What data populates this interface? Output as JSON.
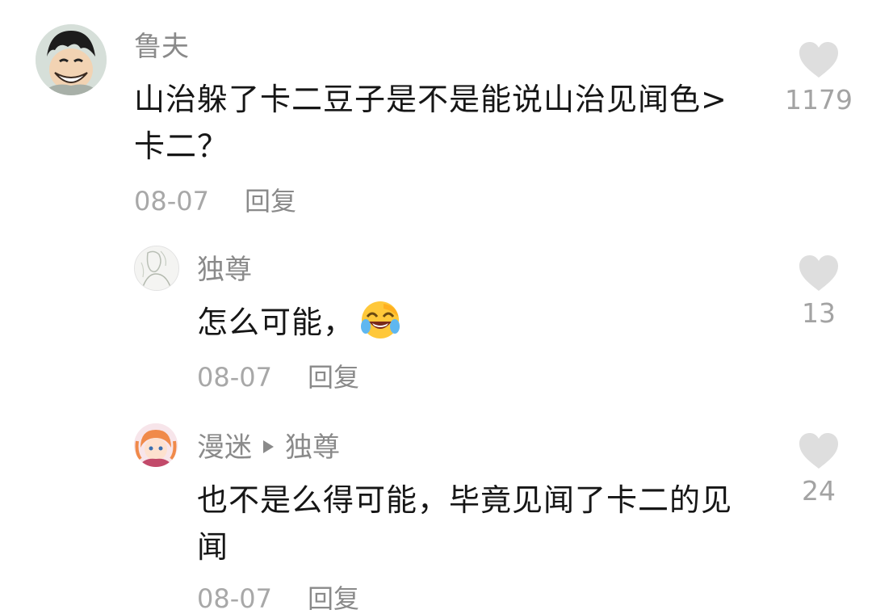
{
  "comments": [
    {
      "username": "鲁夫",
      "text": "山治躲了卡二豆子是不是能说山治见闻色>卡二？",
      "date": "08-07",
      "reply_label": "回复",
      "likes": "1179",
      "avatar_icon": "luffy-avatar"
    },
    {
      "username": "独尊",
      "text": "怎么可能，",
      "emoji": "laughing-crying-emoji",
      "date": "08-07",
      "reply_label": "回复",
      "likes": "13",
      "avatar_icon": "sketch-avatar"
    },
    {
      "username": "漫迷",
      "reply_to": "独尊",
      "text": "也不是么得可能，毕竟见闻了卡二的见闻",
      "date": "08-07",
      "reply_label": "回复",
      "likes": "24",
      "avatar_icon": "anime-girl-avatar"
    }
  ],
  "colors": {
    "username": "#8a8a8a",
    "text": "#161616",
    "meta": "#a8a8a8",
    "heart": "#dedede"
  }
}
